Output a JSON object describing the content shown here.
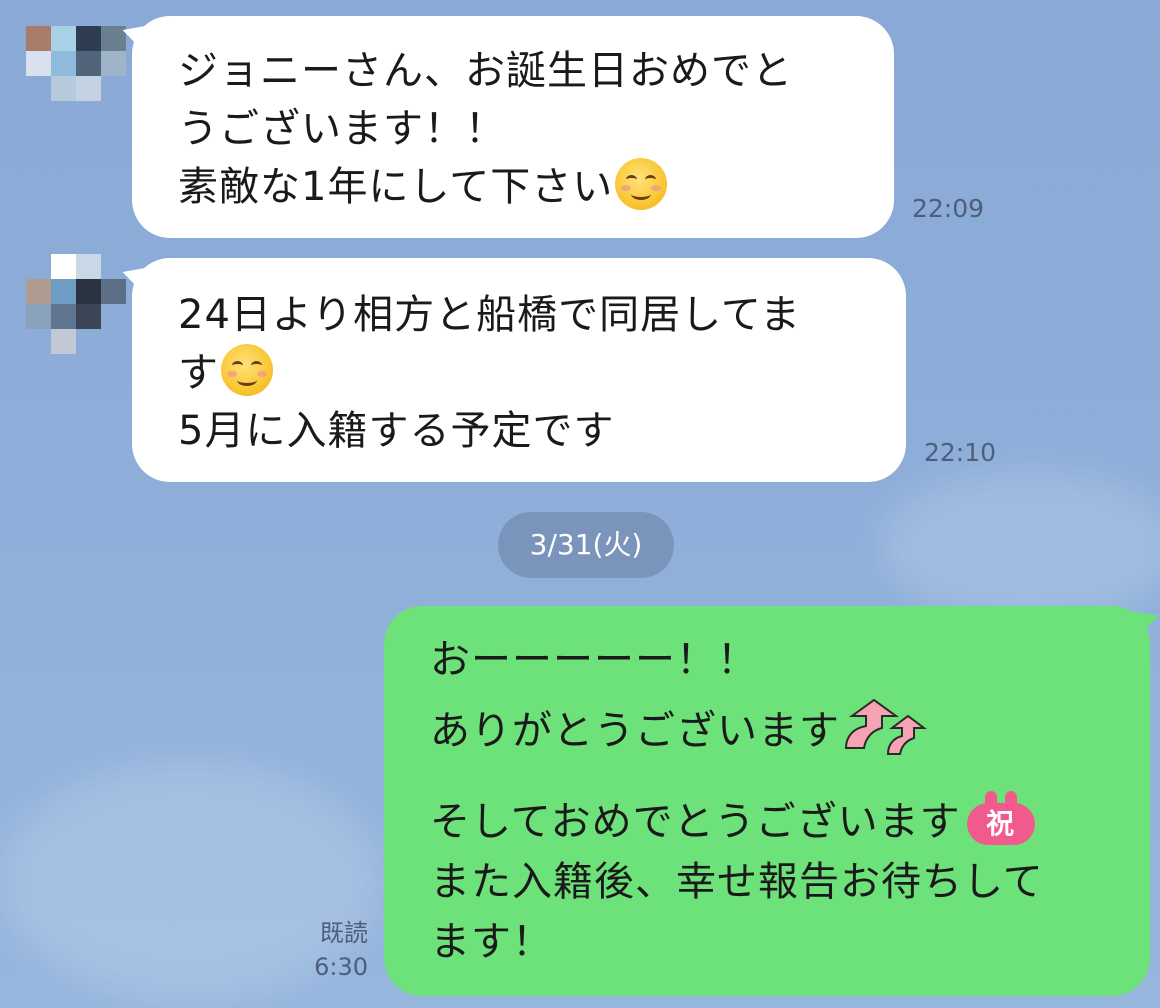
{
  "messages": [
    {
      "side": "incoming",
      "lines": [
        "ジョニーさん、お誕生日おめでと",
        "うございます！！",
        "素敵な1年にして下さい"
      ],
      "time": "22:09"
    },
    {
      "side": "incoming",
      "lines": [
        "24日より相方と船橋で同居してま",
        "す",
        "5月に入籍する予定です"
      ],
      "time": "22:10"
    },
    {
      "side": "outgoing",
      "lines": [
        "おーーーーー！！",
        "ありがとうございます",
        "そしておめでとうございます",
        "また入籍後、幸せ報告お待ちして",
        "ます！"
      ],
      "read_label": "既読",
      "time": "6:30"
    }
  ],
  "date_separator": "3/31(火)",
  "stamps": {
    "smile_emoji": "smiling-face-emoji",
    "arrows_icon": "pink-up-arrows-icon",
    "celebration_icon": "celebration-badge-icon",
    "celebration_text": "祝"
  },
  "colors": {
    "background": "#8eaed9",
    "incoming_bubble": "#ffffff",
    "outgoing_bubble": "#6de27a",
    "date_pill": "#7389ad",
    "accent_pink": "#f05a8c"
  }
}
